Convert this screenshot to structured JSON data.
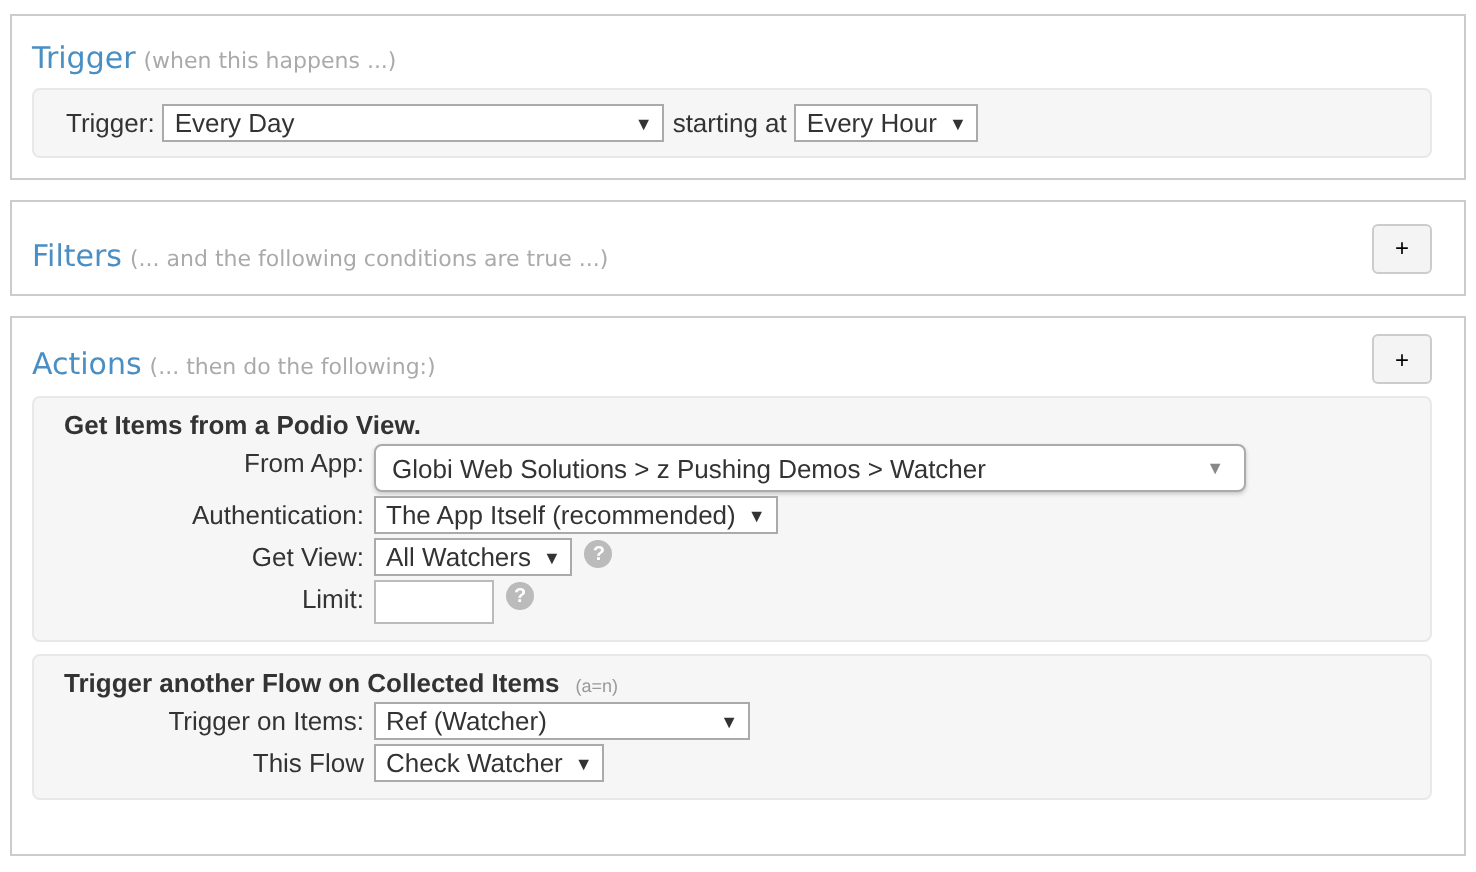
{
  "trigger": {
    "title": "Trigger",
    "hint": "(when this happens ...)",
    "label": "Trigger:",
    "select": {
      "value": "Every Day",
      "arrow": "▼"
    },
    "joiner": "starting at",
    "select2": {
      "value": "Every Hour",
      "arrow": "▼"
    }
  },
  "filters": {
    "title": "Filters",
    "hint": "(... and the following conditions are true ...)",
    "add": "+"
  },
  "actions": {
    "title": "Actions",
    "hint": "(... then do the following:)",
    "add": "+",
    "blocks": [
      {
        "title": "Get Items from a Podio View.",
        "rows": [
          {
            "kind": "combo",
            "label": "From App:",
            "value": "Globi Web Solutions > z Pushing Demos > Watcher",
            "arrow": "▼"
          },
          {
            "kind": "select",
            "label": "Authentication:",
            "value": "The App Itself (recommended)",
            "arrow": "▼"
          },
          {
            "kind": "select",
            "label": "Get View:",
            "value": "All Watchers",
            "arrow": "▼",
            "help": "?"
          },
          {
            "kind": "input",
            "label": "Limit:",
            "help": "?"
          }
        ]
      },
      {
        "title": "Trigger another Flow on Collected Items",
        "note": "(a=n)",
        "rows": [
          {
            "kind": "select",
            "label": "Trigger on Items:",
            "value": "Ref (Watcher)",
            "arrow": "▼"
          },
          {
            "kind": "select",
            "label": "This Flow",
            "value": "Check Watcher",
            "arrow": "▼"
          }
        ]
      }
    ]
  }
}
